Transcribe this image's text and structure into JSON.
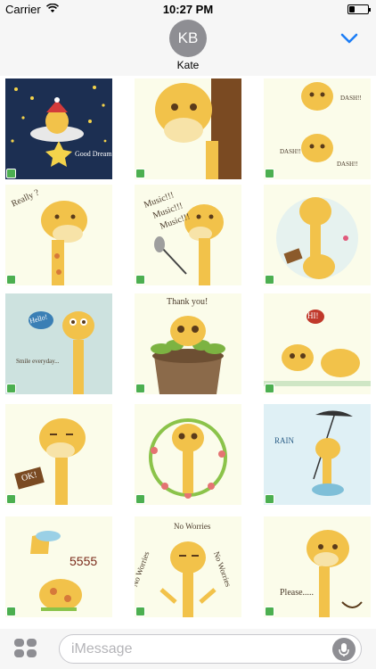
{
  "status_bar": {
    "carrier": "Carrier",
    "time": "10:27 PM",
    "wifi_icon": "wifi-icon",
    "battery_icon": "battery-icon"
  },
  "header": {
    "avatar_initials": "KB",
    "contact_name": "Kate",
    "collapse_icon": "chevron-down-icon",
    "accent_color": "#1d7ef6"
  },
  "stickers": [
    {
      "caption": "Good Dream"
    },
    {
      "caption": ""
    },
    {
      "caption": "DASH!!",
      "caption2": "DASH!!",
      "caption3": "DASH!!"
    },
    {
      "caption": "Really ?"
    },
    {
      "caption": "Music!!!",
      "caption2": "Music!!!",
      "caption3": "Music!!!"
    },
    {
      "caption": ""
    },
    {
      "caption": "Hello!",
      "caption2": "Smile everyday..."
    },
    {
      "caption": "Thank you!"
    },
    {
      "caption": "HI!"
    },
    {
      "caption": "OK!"
    },
    {
      "caption": ""
    },
    {
      "caption": "RAIN"
    },
    {
      "caption": "5555"
    },
    {
      "caption": "No Worries",
      "caption2": "No Worries",
      "caption3": "No Worries"
    },
    {
      "caption": "Please....."
    }
  ],
  "bottom_bar": {
    "apps_icon": "apps-icon",
    "message_placeholder": "iMessage",
    "mic_icon": "microphone-icon"
  }
}
